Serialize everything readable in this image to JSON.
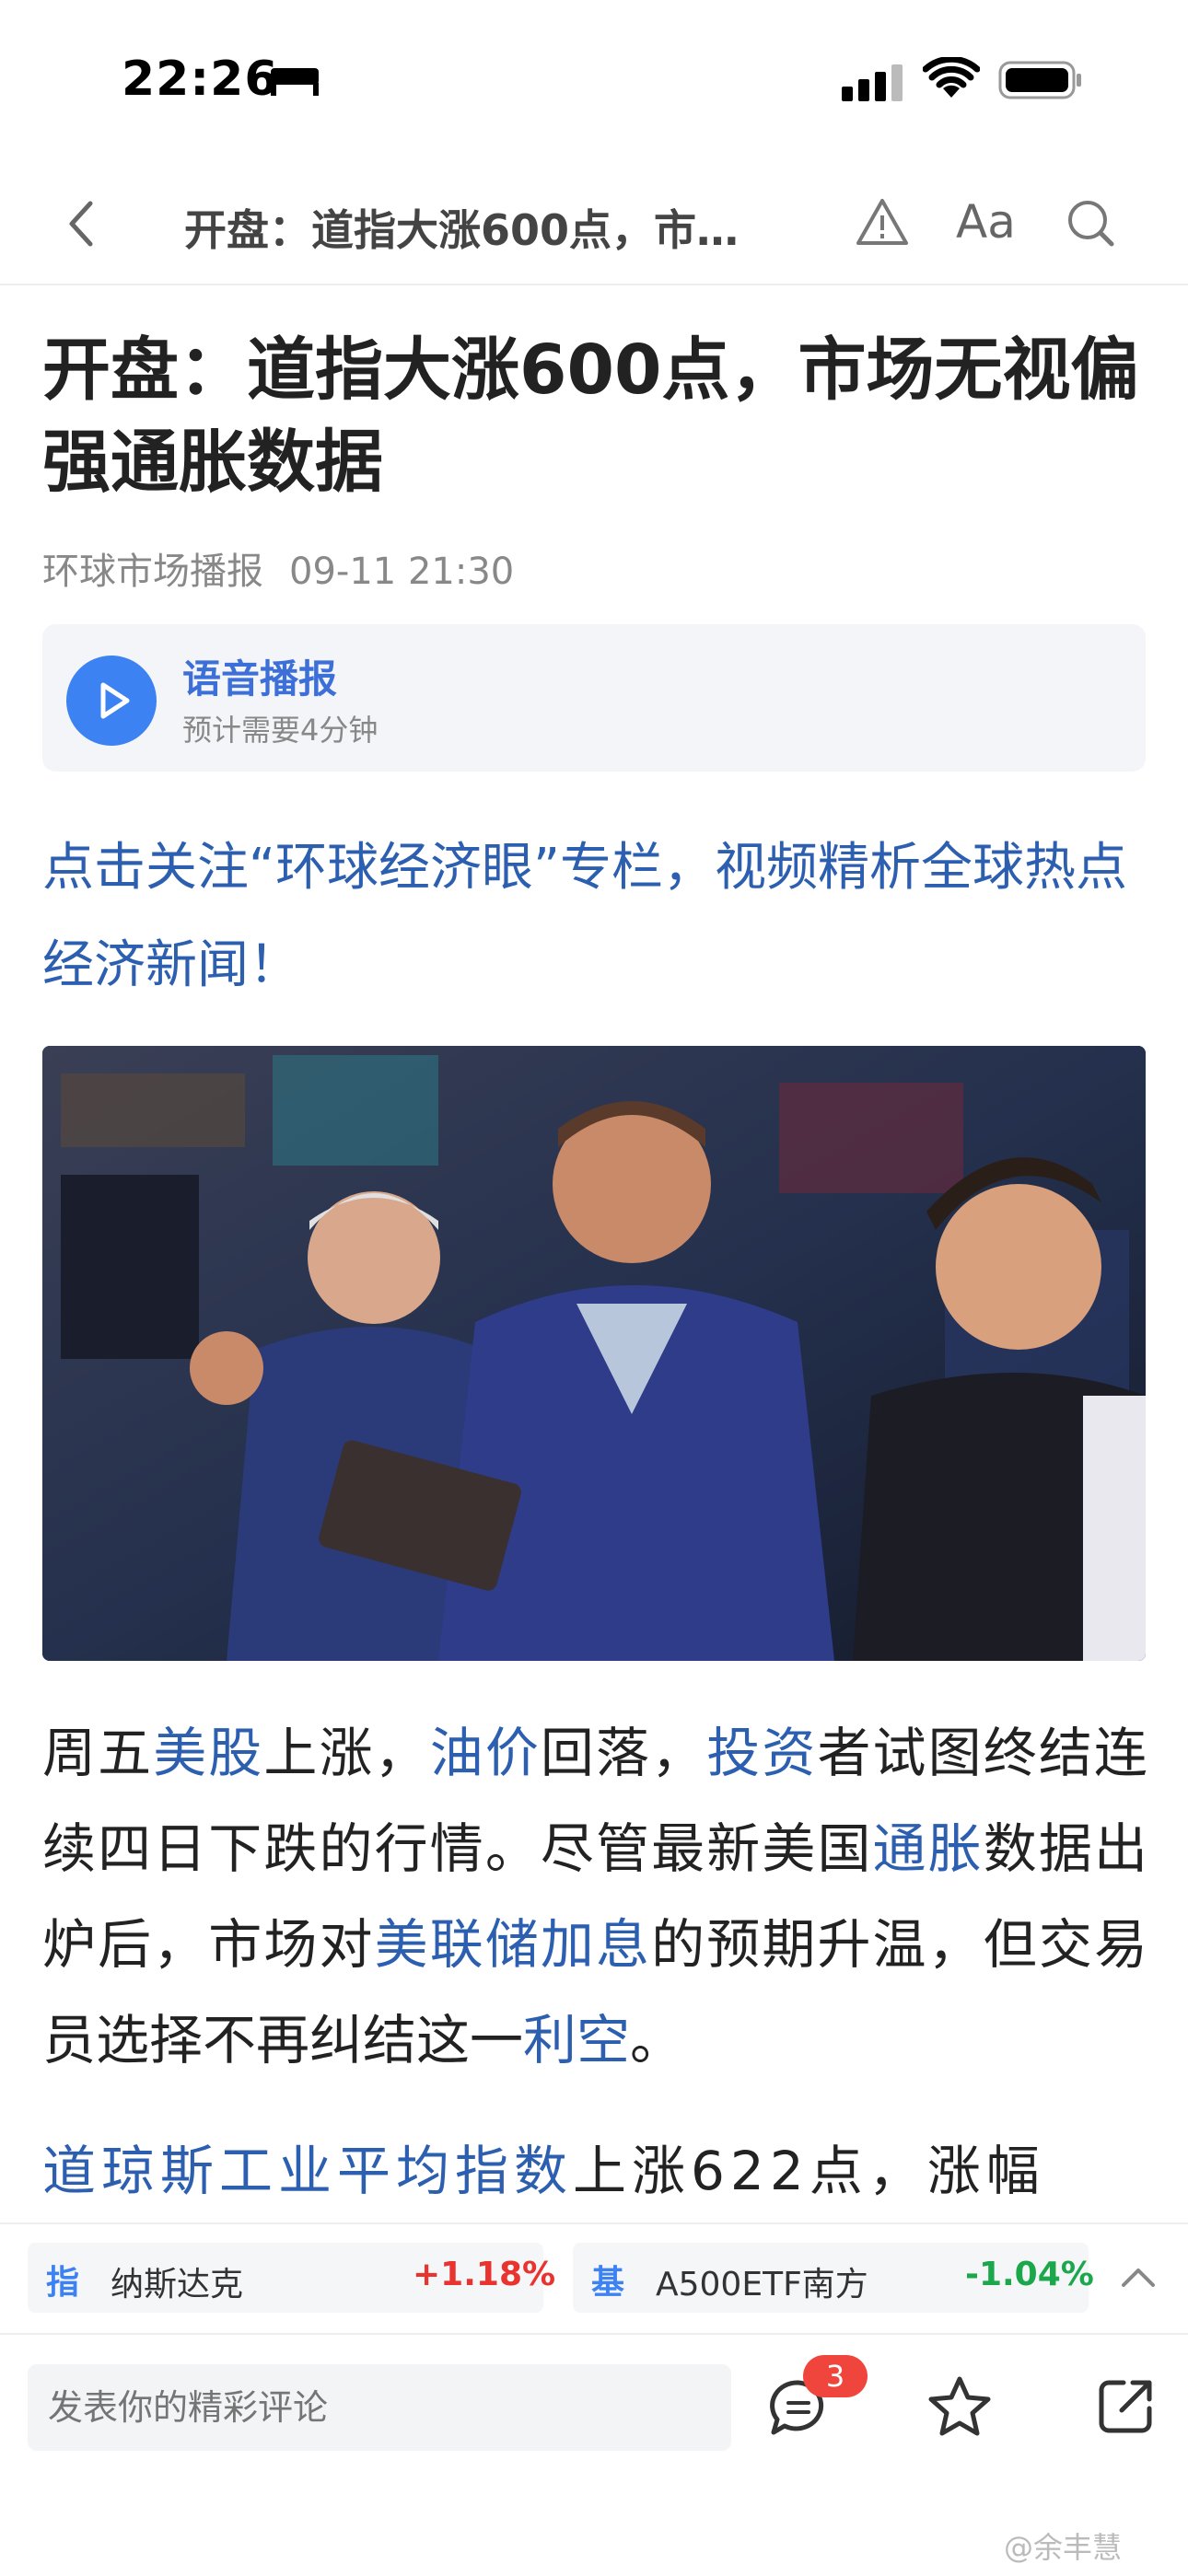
{
  "status_bar": {
    "time": "22:26"
  },
  "nav": {
    "title": "开盘：道指大涨600点，市…",
    "font_label": "Aa"
  },
  "article": {
    "headline": "开盘：道指大涨600点，市场无视偏强通胀数据",
    "source": "环球市场播报",
    "datetime": "09-11 21:30",
    "audio": {
      "title": "语音播报",
      "subtitle": "预计需要4分钟"
    },
    "promo": "点击关注“环球经济眼”专栏，视频精析全球热点经济新闻！",
    "p1": {
      "t1": "周五",
      "l1": "美股",
      "t2": "上涨，",
      "l2": "油价",
      "t3": "回落，",
      "l3": "投资",
      "t4": "者试图终结连续四日下跌的行情。尽管最新美国",
      "l4": "通胀",
      "t5": "数据出炉后，市场对",
      "l5": "美联储加息",
      "t6": "的预期升温，但交易员选择不再纠结这一",
      "l6": "利空",
      "t7": "。"
    },
    "p2": {
      "l1": "道琼斯工业平均指数",
      "t1": "上涨622点，涨幅"
    }
  },
  "tickers": [
    {
      "tag": "指",
      "name": "纳斯达克",
      "change": "+1.18%",
      "direction": "up"
    },
    {
      "tag": "基",
      "name": "A500ETF南方",
      "change": "-1.04%",
      "direction": "down"
    }
  ],
  "bottom_bar": {
    "comment_placeholder": "发表你的精彩评论",
    "comment_count": "3"
  },
  "watermark": "@余丰慧",
  "colors": {
    "link": "#2d5fb0",
    "accent": "#3d82f2",
    "up": "#e8332f",
    "down": "#1ca74c",
    "badge": "#f0453c"
  }
}
